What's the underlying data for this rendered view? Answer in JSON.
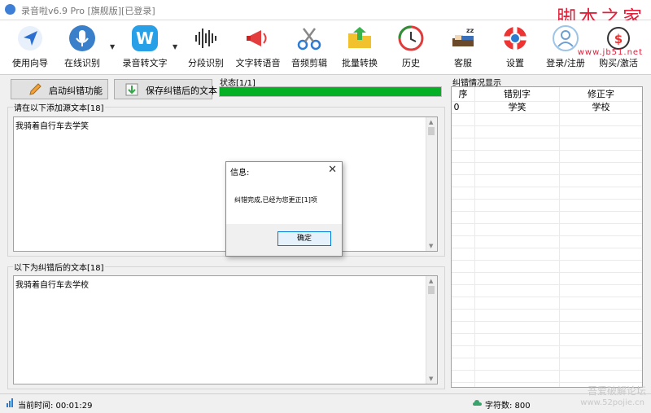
{
  "window": {
    "title": "录音啦v6.9 Pro [旗舰版][已登录]"
  },
  "watermark": {
    "brand": "脚本之家",
    "url": "www.jb51.net",
    "bottom_line1": "吾爱破解论坛",
    "bottom_line2": "www.52pojie.cn"
  },
  "toolbar": {
    "items": [
      {
        "label": "使用向导",
        "icon": "navigation-arrow-icon"
      },
      {
        "label": "在线识别",
        "icon": "microphone-icon"
      },
      {
        "label": "录音转文字",
        "icon": "w-app-icon"
      },
      {
        "label": "分段识别",
        "icon": "waveform-icon"
      },
      {
        "label": "文字转语音",
        "icon": "megaphone-icon"
      },
      {
        "label": "音频剪辑",
        "icon": "scissors-icon"
      },
      {
        "label": "批量转换",
        "icon": "folder-arrow-icon"
      },
      {
        "label": "历史",
        "icon": "history-clock-icon"
      },
      {
        "label": "客服",
        "icon": "sleep-bed-icon"
      },
      {
        "label": "设置",
        "icon": "lifebuoy-icon"
      },
      {
        "label": "登录/注册",
        "icon": "user-avatar-icon"
      },
      {
        "label": "购买/激活",
        "icon": "purchase-icon"
      }
    ]
  },
  "actions": {
    "start_correction": "启动纠错功能",
    "save_corrected": "保存纠错后的文本"
  },
  "status": {
    "label": "状态[1/1]",
    "progress": 1.0,
    "color": "#06b025"
  },
  "source": {
    "label": "请在以下添加源文本[18]",
    "text": "我骑着自行车去学笑"
  },
  "corrected": {
    "label": "以下为纠错后的文本[18]",
    "text": "我骑着自行车去学校"
  },
  "correction_panel": {
    "label": "纠错情况显示",
    "columns": [
      "序",
      "错别字",
      "修正字"
    ],
    "rows": [
      [
        "0",
        "学笑",
        "学校"
      ]
    ]
  },
  "dialog": {
    "title": "信息:",
    "message": "纠错完成,已经为您更正[1]项",
    "ok": "确定"
  },
  "statusbar": {
    "time_label": "当前时间: 00:01:29",
    "chars_label": "字符数: 800"
  }
}
